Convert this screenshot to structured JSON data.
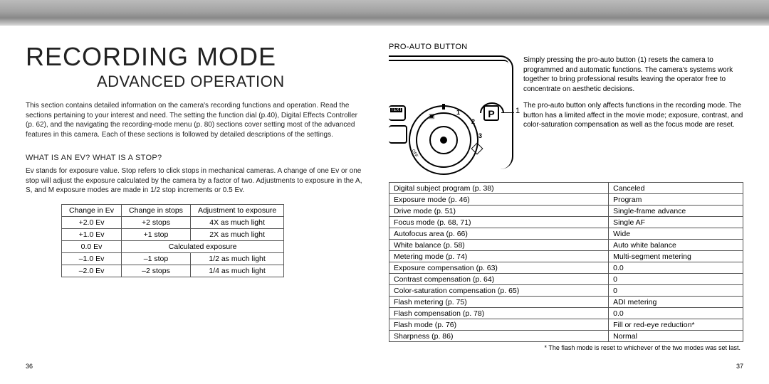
{
  "left": {
    "title": "RECORDING MODE",
    "subtitle": "ADVANCED OPERATION",
    "intro": "This section contains detailed information on the camera's recording functions and operation. Read the sections pertaining to your interest and need. The setting the function dial (p.40), Digital Effects Controller (p. 62), and the navigating the recording-mode menu (p. 80) sections cover setting most of the advanced features in this camera. Each of these sections is followed by detailed descriptions of the settings.",
    "ev_heading": "WHAT IS AN EV? WHAT IS A STOP?",
    "ev_text": "Ev stands for exposure value. Stop refers to click stops in mechanical cameras. A change of one Ev or one stop will adjust the exposure calculated by the camera by a factor of two. Adjustments to exposure in the A, S, and M exposure modes are made in 1/2 stop increments or 0.5 Ev.",
    "ev_table": {
      "headers": [
        "Change in Ev",
        "Change in stops",
        "Adjustment to exposure"
      ],
      "rows": [
        [
          "+2.0 Ev",
          "+2 stops",
          "4X as much light"
        ],
        [
          "+1.0 Ev",
          "+1 stop",
          "2X as much light"
        ],
        [
          "0.0 Ev",
          "__SPAN__",
          "Calculated exposure"
        ],
        [
          "–1.0 Ev",
          "–1 stop",
          "1/2 as much light"
        ],
        [
          "–2.0 Ev",
          "–2 stops",
          "1/4 as much light"
        ]
      ]
    },
    "page": "36"
  },
  "right": {
    "heading": "PRO-AUTO BUTTON",
    "para1": "Simply pressing the pro-auto button (1) resets the camera to programmed and automatic functions. The camera's systems work together to bring professional results leaving the operator free to concentrate on aesthetic decisions.",
    "para2": "The pro-auto button only affects functions in the recording mode. The button has a limited affect in the movie mode; exposure, contrast, and color-saturation compensation as well as the focus mode are reset.",
    "diagram": {
      "p_label": "P",
      "callout": "1",
      "text_label": "TEXT"
    },
    "reset_table": [
      [
        "Digital subject program (p. 38)",
        "Canceled"
      ],
      [
        "Exposure mode (p. 46)",
        "Program"
      ],
      [
        "Drive mode (p. 51)",
        "Single-frame advance"
      ],
      [
        "Focus mode (p. 68, 71)",
        "Single AF"
      ],
      [
        "Autofocus area (p. 66)",
        "Wide"
      ],
      [
        "White balance (p. 58)",
        "Auto white balance"
      ],
      [
        "Metering mode (p. 74)",
        "Multi-segment metering"
      ],
      [
        "Exposure compensation (p. 63)",
        "0.0"
      ],
      [
        "Contrast compensation (p. 64)",
        "0"
      ],
      [
        "Color-saturation compensation (p. 65)",
        "0"
      ],
      [
        "Flash metering (p. 75)",
        "ADI metering"
      ],
      [
        "Flash compensation (p. 78)",
        "0.0"
      ],
      [
        "Flash mode (p. 76)",
        "Fill or red-eye reduction*"
      ],
      [
        "Sharpness (p. 86)",
        "Normal"
      ]
    ],
    "footnote": "* The flash mode is reset to whichever of the two modes was set last.",
    "page": "37"
  }
}
